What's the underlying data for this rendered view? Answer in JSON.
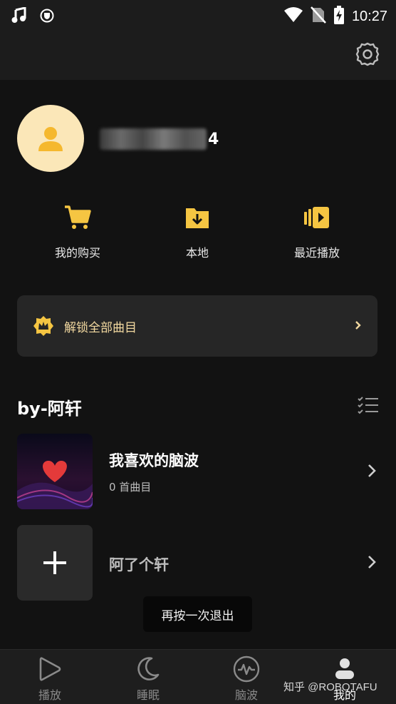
{
  "status_bar": {
    "time": "10:27",
    "icons": [
      "music-note-icon",
      "shield-icon",
      "wifi-icon",
      "no-sim-icon",
      "battery-charging-icon"
    ]
  },
  "header": {
    "settings_icon": "gear-icon"
  },
  "profile": {
    "avatar_icon": "user-icon",
    "username_visible_suffix": "4"
  },
  "quick_actions": [
    {
      "label": "我的购买",
      "icon": "cart-icon"
    },
    {
      "label": "本地",
      "icon": "download-folder-icon"
    },
    {
      "label": "最近播放",
      "icon": "recent-play-icon"
    }
  ],
  "unlock": {
    "label": "解锁全部曲目",
    "icon": "crown-badge-icon"
  },
  "section": {
    "title": "by-阿轩",
    "list_icon": "checklist-icon"
  },
  "playlists": [
    {
      "title": "我喜欢的脑波",
      "subtitle": "0 首曲目"
    },
    {
      "title": "阿了个轩"
    }
  ],
  "toast": "再按一次退出",
  "tabs": [
    {
      "label": "播放",
      "icon": "play-icon",
      "active": false
    },
    {
      "label": "睡眠",
      "icon": "moon-icon",
      "active": false
    },
    {
      "label": "脑波",
      "icon": "brainwave-icon",
      "active": false
    },
    {
      "label": "我的",
      "icon": "person-icon",
      "active": true
    }
  ],
  "watermark": "知乎 @ROBOTAFU",
  "colors": {
    "background": "#121212",
    "card": "#262626",
    "accent_gold": "#f5c542",
    "avatar_bg": "#fbe7b8",
    "unlock_text": "#f3d9a0"
  }
}
